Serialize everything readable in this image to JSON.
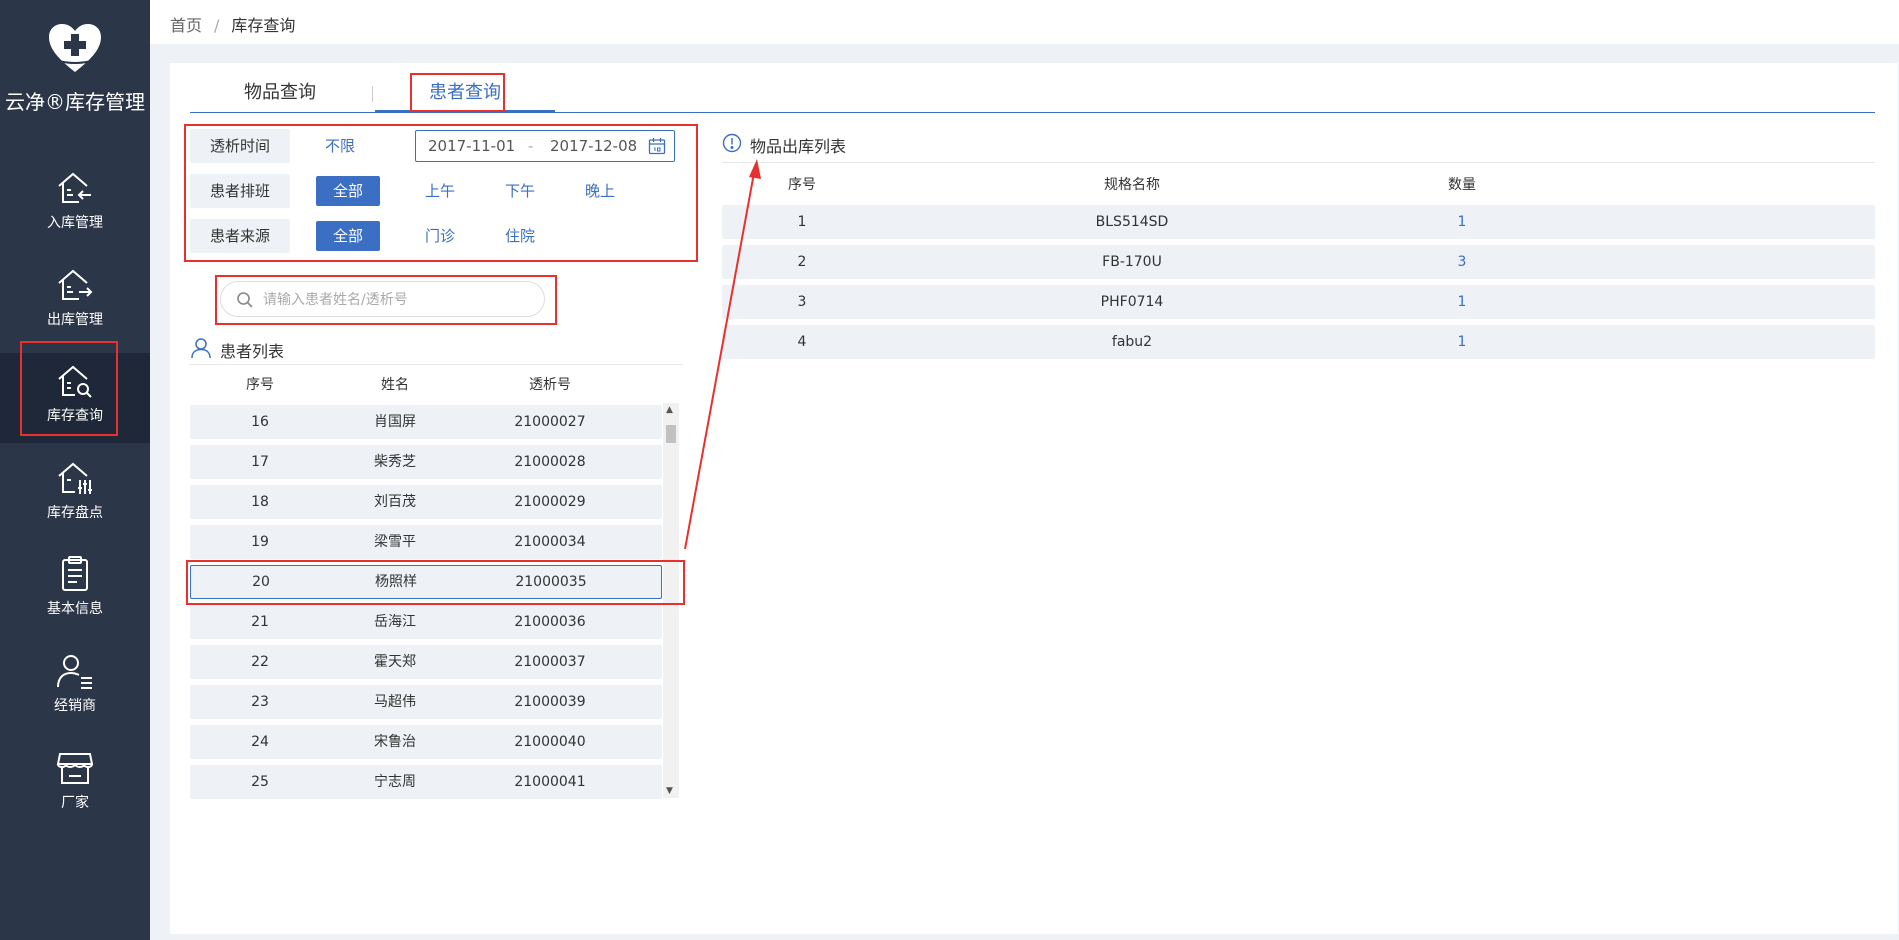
{
  "app": {
    "logo_text": "云净®库存管理"
  },
  "sidebar": {
    "items": [
      {
        "label": "入库管理",
        "icon": "stock-in-icon"
      },
      {
        "label": "出库管理",
        "icon": "stock-out-icon"
      },
      {
        "label": "库存查询",
        "icon": "stock-search-icon",
        "active": true
      },
      {
        "label": "库存盘点",
        "icon": "stock-check-icon"
      },
      {
        "label": "基本信息",
        "icon": "clipboard-icon"
      },
      {
        "label": "经销商",
        "icon": "user-list-icon"
      },
      {
        "label": "厂家",
        "icon": "store-icon"
      }
    ]
  },
  "breadcrumb": {
    "home": "首页",
    "separator": "/",
    "current": "库存查询"
  },
  "tabs": [
    {
      "label": "物品查询",
      "active": false
    },
    {
      "label": "患者查询",
      "active": true
    }
  ],
  "filters": {
    "dialysis_time": {
      "label": "透析时间",
      "unlimited": "不限",
      "start": "2017-11-01",
      "dash": "-",
      "end": "2017-12-08"
    },
    "shift": {
      "label": "患者排班",
      "options": [
        "全部",
        "上午",
        "下午",
        "晚上"
      ],
      "selected": "全部"
    },
    "source": {
      "label": "患者来源",
      "options": [
        "全部",
        "门诊",
        "住院"
      ],
      "selected": "全部"
    }
  },
  "search": {
    "placeholder": "请输入患者姓名/透析号",
    "value": ""
  },
  "patient_list": {
    "title": "患者列表",
    "headers": [
      "序号",
      "姓名",
      "透析号"
    ],
    "rows": [
      {
        "no": "16",
        "name": "肖国屏",
        "id": "21000027"
      },
      {
        "no": "17",
        "name": "柴秀芝",
        "id": "21000028"
      },
      {
        "no": "18",
        "name": "刘百茂",
        "id": "21000029"
      },
      {
        "no": "19",
        "name": "梁雪平",
        "id": "21000034"
      },
      {
        "no": "20",
        "name": "杨照样",
        "id": "21000035",
        "selected": true
      },
      {
        "no": "21",
        "name": "岳海江",
        "id": "21000036"
      },
      {
        "no": "22",
        "name": "霍天郑",
        "id": "21000037"
      },
      {
        "no": "23",
        "name": "马超伟",
        "id": "21000039"
      },
      {
        "no": "24",
        "name": "宋鲁治",
        "id": "21000040"
      },
      {
        "no": "25",
        "name": "宁志周",
        "id": "21000041"
      }
    ]
  },
  "outbound_list": {
    "title": "物品出库列表",
    "headers": [
      "序号",
      "规格名称",
      "数量"
    ],
    "rows": [
      {
        "no": "1",
        "spec": "BLS514SD",
        "qty": "1"
      },
      {
        "no": "2",
        "spec": "FB-170U",
        "qty": "3"
      },
      {
        "no": "3",
        "spec": "PHF0714",
        "qty": "1"
      },
      {
        "no": "4",
        "spec": "fabu2",
        "qty": "1"
      }
    ]
  },
  "colors": {
    "sidebar_bg": "#2b3648",
    "accent": "#3a6fc4",
    "annotation_red": "#e8302f"
  }
}
